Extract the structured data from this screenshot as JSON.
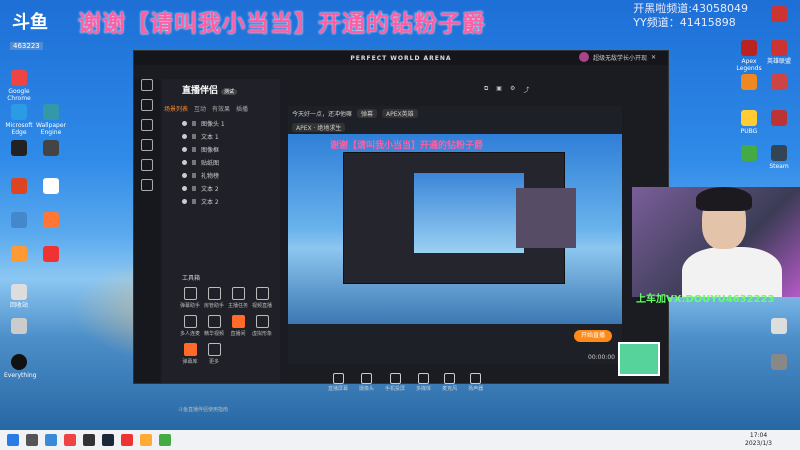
{
  "overlay": {
    "title": "谢谢【请叫我小当当】开通的钻粉子爵",
    "info_line1": "开黑啦频道:43058049",
    "info_line2": "YY频道：41415898"
  },
  "logo": {
    "text": "斗鱼",
    "sub": "463223"
  },
  "app": {
    "window_title": "PERFECT WORLD ARENA",
    "brand": "直播伴侣",
    "brand_tag": "测试",
    "tabs": [
      "场景列表",
      "互动",
      "有效果",
      "插播"
    ],
    "scenes": [
      "图像头 1",
      "文本 1",
      "图像框",
      "贴纸图",
      "礼物榜",
      "文本 2",
      "文本 2"
    ],
    "tools_label": "工具箱",
    "tools": [
      "弹幕助手",
      "房管助手",
      "主播任务",
      "视频直播",
      "多人连麦",
      "精华视频",
      "直播间",
      "虚拟形象",
      "弹幕库",
      "更多"
    ],
    "notice": "斗鱼直播伴侣使用指南",
    "preview_title": "今天好一点，还冲他嘛",
    "preview_chip1": "弹幕",
    "preview_chip2": "APEX英雄",
    "preview_meta": "APEX · 绝地求生",
    "preview_overlay_text": "谢谢【请叫我小当当】开通的钻粉子爵",
    "bottom_buttons": [
      "直播屏幕",
      "摄像头",
      "手机投屏",
      "多媒体",
      "麦克风",
      "扬声器"
    ],
    "start_button": "开始直播",
    "timer": "00:00:00",
    "account": "超级无敌学长小开现"
  },
  "cam": {
    "caption": "上车加VX:DOUYU4632223"
  },
  "taskbar": {
    "time": "17:04",
    "date": "2023/1/3"
  },
  "desktop_icons": [
    "Google Chrome",
    "Microsoft Edge",
    "Wallpaper Engine",
    "Apex Legends",
    "英雄联盟",
    "Steam",
    "回收站",
    "Everything",
    "此电脑",
    "PUBG"
  ]
}
